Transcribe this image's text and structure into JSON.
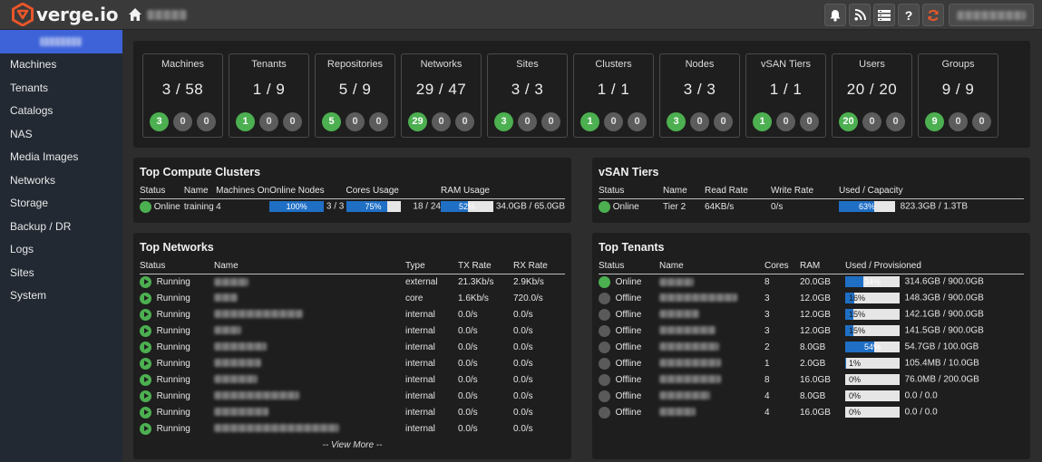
{
  "app": {
    "logo_text": "verge.io"
  },
  "topbar": {
    "icons": [
      "bell-icon",
      "rss-icon",
      "list-icon",
      "help-icon",
      "refresh-icon"
    ],
    "help_glyph": "?"
  },
  "sidebar": {
    "items": [
      {
        "label": "Machines"
      },
      {
        "label": "Tenants"
      },
      {
        "label": "Catalogs"
      },
      {
        "label": "NAS"
      },
      {
        "label": "Media Images"
      },
      {
        "label": "Networks"
      },
      {
        "label": "Storage"
      },
      {
        "label": "Backup / DR"
      },
      {
        "label": "Logs"
      },
      {
        "label": "Sites"
      },
      {
        "label": "System"
      }
    ]
  },
  "stats": [
    {
      "label": "Machines",
      "value": "3 / 58",
      "green": "3",
      "mid": "0",
      "right": "0"
    },
    {
      "label": "Tenants",
      "value": "1 / 9",
      "green": "1",
      "mid": "0",
      "right": "0"
    },
    {
      "label": "Repositories",
      "value": "5 / 9",
      "green": "5",
      "mid": "0",
      "right": "0"
    },
    {
      "label": "Networks",
      "value": "29 / 47",
      "green": "29",
      "mid": "0",
      "right": "0"
    },
    {
      "label": "Sites",
      "value": "3 / 3",
      "green": "3",
      "mid": "0",
      "right": "0"
    },
    {
      "label": "Clusters",
      "value": "1 / 1",
      "green": "1",
      "mid": "0",
      "right": "0"
    },
    {
      "label": "Nodes",
      "value": "3 / 3",
      "green": "3",
      "mid": "0",
      "right": "0"
    },
    {
      "label": "vSAN Tiers",
      "value": "1 / 1",
      "green": "1",
      "mid": "0",
      "right": "0"
    },
    {
      "label": "Users",
      "value": "20 / 20",
      "green": "20",
      "mid": "0",
      "right": "0"
    },
    {
      "label": "Groups",
      "value": "9 / 9",
      "green": "9",
      "mid": "0",
      "right": "0"
    }
  ],
  "clusters": {
    "title": "Top Compute Clusters",
    "headers": {
      "status": "Status",
      "name": "Name",
      "machines": "Machines On",
      "nodes": "Online Nodes",
      "cores": "Cores Usage",
      "ram": "RAM Usage"
    },
    "row": {
      "status": "Online",
      "name": "training",
      "machines": "4",
      "nodes_pct": 100,
      "nodes_pct_label": "100%",
      "nodes_text": "3 / 3",
      "cores_pct": 75,
      "cores_pct_label": "75%",
      "cores_text": "18 / 24",
      "ram_pct": 52,
      "ram_pct_label": "52%",
      "ram_text": "34.0GB / 65.0GB"
    }
  },
  "vsan": {
    "title": "vSAN Tiers",
    "headers": {
      "status": "Status",
      "name": "Name",
      "read": "Read Rate",
      "write": "Write Rate",
      "used": "Used / Capacity"
    },
    "row": {
      "status": "Online",
      "name": "Tier 2",
      "read": "64KB/s",
      "write": "0/s",
      "pct": 63,
      "pct_label": "63%",
      "used": "823.3GB / 1.3TB"
    }
  },
  "networks": {
    "title": "Top Networks",
    "headers": {
      "status": "Status",
      "name": "Name",
      "type": "Type",
      "tx": "TX Rate",
      "rx": "RX Rate"
    },
    "rows": [
      {
        "status": "Running",
        "type": "external",
        "tx": "21.3Kb/s",
        "rx": "2.9Kb/s"
      },
      {
        "status": "Running",
        "type": "core",
        "tx": "1.6Kb/s",
        "rx": "720.0/s"
      },
      {
        "status": "Running",
        "type": "internal",
        "tx": "0.0/s",
        "rx": "0.0/s"
      },
      {
        "status": "Running",
        "type": "internal",
        "tx": "0.0/s",
        "rx": "0.0/s"
      },
      {
        "status": "Running",
        "type": "internal",
        "tx": "0.0/s",
        "rx": "0.0/s"
      },
      {
        "status": "Running",
        "type": "internal",
        "tx": "0.0/s",
        "rx": "0.0/s"
      },
      {
        "status": "Running",
        "type": "internal",
        "tx": "0.0/s",
        "rx": "0.0/s"
      },
      {
        "status": "Running",
        "type": "internal",
        "tx": "0.0/s",
        "rx": "0.0/s"
      },
      {
        "status": "Running",
        "type": "internal",
        "tx": "0.0/s",
        "rx": "0.0/s"
      },
      {
        "status": "Running",
        "type": "internal",
        "tx": "0.0/s",
        "rx": "0.0/s"
      }
    ],
    "view_more": "-- View More --"
  },
  "tenants": {
    "title": "Top Tenants",
    "headers": {
      "status": "Status",
      "name": "Name",
      "cores": "Cores",
      "ram": "RAM",
      "used": "Used / Provisioned"
    },
    "rows": [
      {
        "status": "Online",
        "cores": "8",
        "ram": "20.0GB",
        "pct": 34,
        "pct_label": "34%",
        "used": "314.6GB / 900.0GB"
      },
      {
        "status": "Offline",
        "cores": "3",
        "ram": "12.0GB",
        "pct": 16,
        "pct_label": "16%",
        "used": "148.3GB / 900.0GB"
      },
      {
        "status": "Offline",
        "cores": "3",
        "ram": "12.0GB",
        "pct": 15,
        "pct_label": "15%",
        "used": "142.1GB / 900.0GB"
      },
      {
        "status": "Offline",
        "cores": "3",
        "ram": "12.0GB",
        "pct": 15,
        "pct_label": "15%",
        "used": "141.5GB / 900.0GB"
      },
      {
        "status": "Offline",
        "cores": "2",
        "ram": "8.0GB",
        "pct": 54,
        "pct_label": "54%",
        "used": "54.7GB / 100.0GB"
      },
      {
        "status": "Offline",
        "cores": "1",
        "ram": "2.0GB",
        "pct": 1,
        "pct_label": "1%",
        "used": "105.4MB / 10.0GB"
      },
      {
        "status": "Offline",
        "cores": "8",
        "ram": "16.0GB",
        "pct": 0,
        "pct_label": "0%",
        "used": "76.0MB / 200.0GB"
      },
      {
        "status": "Offline",
        "cores": "4",
        "ram": "8.0GB",
        "pct": 0,
        "pct_label": "0%",
        "used": "0.0 / 0.0"
      },
      {
        "status": "Offline",
        "cores": "4",
        "ram": "16.0GB",
        "pct": 0,
        "pct_label": "0%",
        "used": "0.0 / 0.0"
      }
    ]
  },
  "colors": {
    "accent_blue": "#3e63d9",
    "status_green": "#4caf50",
    "bar_blue": "#1f6fc5",
    "logo_orange": "#e8562a"
  }
}
